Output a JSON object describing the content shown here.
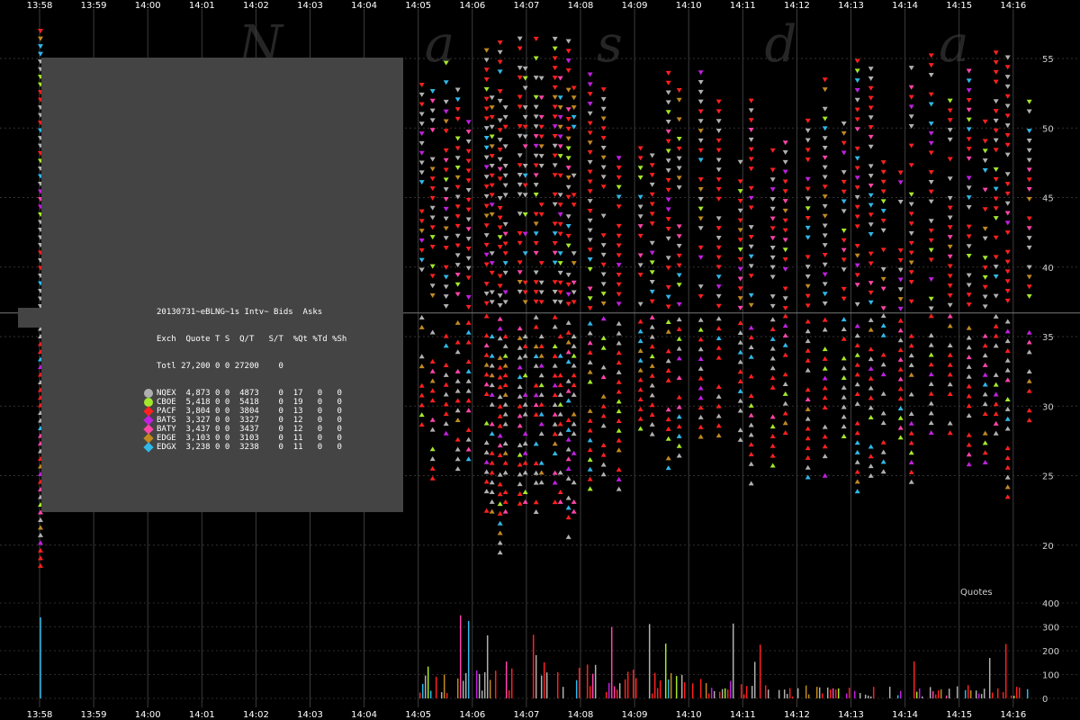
{
  "chart_data": {
    "type": "scatter",
    "title": "20130731~eBLNG~1s Intv~ Bids  Asks",
    "watermark": "N a s d a q",
    "xaxis": {
      "ticks": [
        "13:58",
        "13:59",
        "14:00",
        "14:01",
        "14:02",
        "14:03",
        "14:04",
        "14:05",
        "14:06",
        "14:07",
        "14:08",
        "14:09",
        "14:10",
        "14:11",
        "14:12",
        "14:13",
        "14:14",
        "14:15",
        "14:16"
      ]
    },
    "price_axis": {
      "ylim": [
        16,
        58
      ],
      "ticks": [
        20,
        25,
        30,
        35,
        40,
        45,
        50,
        55
      ],
      "reference_line": 36.7
    },
    "quote_axis": {
      "label": "Quotes",
      "ylim": [
        0,
        400
      ],
      "ticks": [
        0,
        100,
        200,
        300,
        400
      ]
    },
    "activity": {
      "description_only": false,
      "minute_13_58": {
        "price_range": [
          18.5,
          57.5
        ],
        "max_quotes": 340
      },
      "bursts": [
        {
          "start": "14:05",
          "end": "14:16",
          "bid_range": [
            20.5,
            36.5
          ],
          "ask_range": [
            37.0,
            57.0
          ]
        }
      ]
    },
    "colors": {
      "NQEX": "#b0b0b0",
      "CBOE": "#a4e82a",
      "PACF": "#ff2020",
      "BATS": "#c020e0",
      "BATY": "#ff44aa",
      "EDGE": "#c08a20",
      "EDGX": "#30b8e8"
    }
  },
  "stats": {
    "title": "20130731~eBLNG~1s Intv~ Bids  Asks",
    "header": "Exch  Quote T S  Q/T   S/T  %Qt %Td %Sh",
    "total": "Totl 27,200 0 0 27200    0",
    "rows": [
      {
        "exch": "NQEX",
        "line": "NQEX  4,873 0 0  4873    0  17   0   0",
        "color": "#b0b0b0",
        "shape": "circle"
      },
      {
        "exch": "CBOE",
        "line": "CBOE  5,418 0 0  5418    0  19   0   0",
        "color": "#a4e82a",
        "shape": "circle"
      },
      {
        "exch": "PACF",
        "line": "PACF  3,804 0 0  3804    0  13   0   0",
        "color": "#ff2020",
        "shape": "diamond"
      },
      {
        "exch": "BATS",
        "line": "BATS  3,327 0 0  3327    0  12   0   0",
        "color": "#c020e0",
        "shape": "diamond"
      },
      {
        "exch": "BATY",
        "line": "BATY  3,437 0 0  3437    0  12   0   0",
        "color": "#ff44aa",
        "shape": "diamond"
      },
      {
        "exch": "EDGE",
        "line": "EDGE  3,103 0 0  3103    0  11   0   0",
        "color": "#c08a20",
        "shape": "diamond"
      },
      {
        "exch": "EDGX",
        "line": "EDGX  3,238 0 0  3238    0  11   0   0",
        "color": "#30b8e8",
        "shape": "diamond"
      }
    ]
  }
}
